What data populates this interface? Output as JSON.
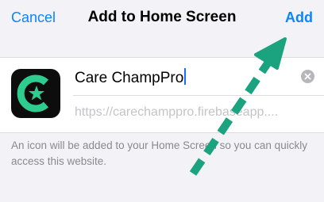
{
  "navbar": {
    "cancel_label": "Cancel",
    "title": "Add to Home Screen",
    "add_label": "Add"
  },
  "shortcut": {
    "name_value": "Care ChampPro",
    "url": "https://carechamppro.firebaseapp...."
  },
  "caption": "An icon will be added to your Home Screen so you can quickly access this website.",
  "colors": {
    "accent": "#0a84ff",
    "icon_green": "#2ecc8f",
    "arrow": "#1aa37e"
  },
  "icons": {
    "app_icon": "care-champ-logo",
    "clear": "clear-circle-x"
  }
}
